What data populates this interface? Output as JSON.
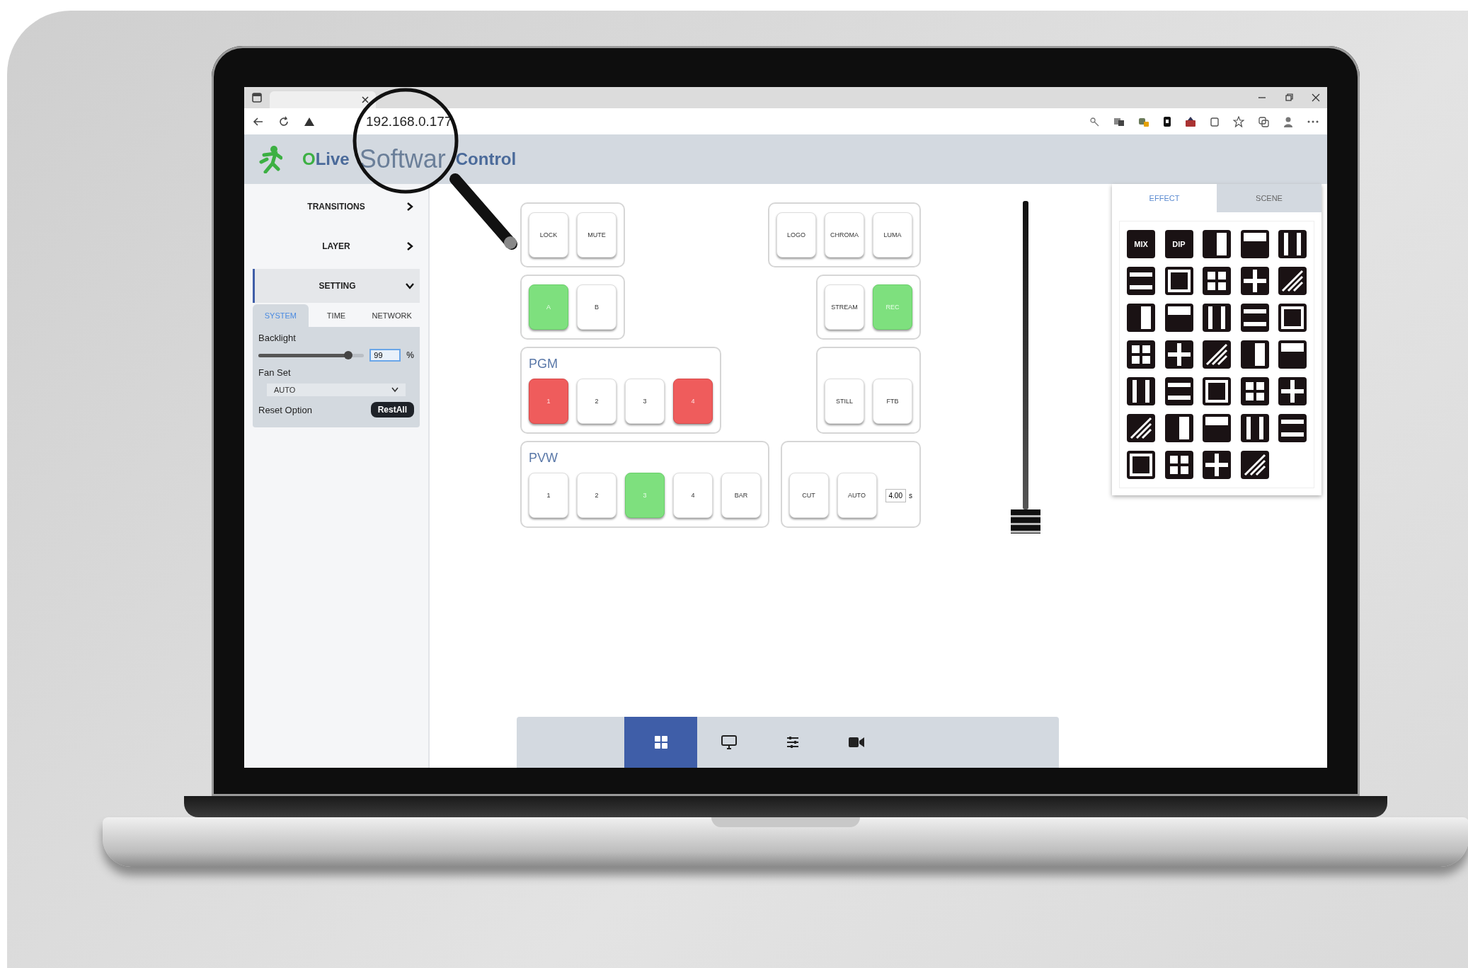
{
  "browser": {
    "address": "192.168.0.177"
  },
  "app": {
    "brand": "OLive",
    "brand_zoomed": "Softwar",
    "brand_suffix": "Control"
  },
  "sidebar": {
    "items": [
      {
        "label": "TRANSITIONS",
        "expanded": false
      },
      {
        "label": "LAYER",
        "expanded": false
      },
      {
        "label": "SETTING",
        "expanded": true
      }
    ]
  },
  "settings": {
    "tabs": [
      {
        "label": "SYSTEM",
        "selected": true
      },
      {
        "label": "TIME",
        "selected": false
      },
      {
        "label": "NETWORK",
        "selected": false
      }
    ],
    "backlight": {
      "label": "Backlight",
      "level": 0.85,
      "value": "99",
      "unit": "%"
    },
    "fan": {
      "label": "Fan Set",
      "value": "AUTO"
    },
    "reset": {
      "label": "Reset Option",
      "button": "RestAll"
    }
  },
  "control_rows": [
    {
      "left": {
        "buttons": [
          {
            "label": "LOCK",
            "selected": false
          },
          {
            "label": "MUTE",
            "selected": false
          }
        ]
      },
      "right": {
        "buttons": [
          {
            "label": "LOGO",
            "selected": false
          },
          {
            "label": "CHROMA",
            "selected": false
          },
          {
            "label": "LUMA",
            "selected": false
          }
        ]
      }
    },
    {
      "left": {
        "kind": "preview",
        "buttons": [
          {
            "label": "A",
            "selected": true
          },
          {
            "label": "B",
            "selected": false
          }
        ]
      },
      "right": {
        "kind": "preview",
        "buttons": [
          {
            "label": "STREAM",
            "selected": false
          },
          {
            "label": "REC",
            "selected": true
          }
        ]
      }
    },
    {
      "left": {
        "kind": "program",
        "title": "PGM",
        "buttons": [
          {
            "label": "1",
            "selected": true
          },
          {
            "label": "2",
            "selected": false
          },
          {
            "label": "3",
            "selected": false
          },
          {
            "label": "4",
            "selected": true
          }
        ]
      },
      "right": {
        "buttons": [
          {
            "label": "STILL",
            "selected": false
          },
          {
            "label": "FTB",
            "selected": false
          }
        ]
      }
    },
    {
      "left": {
        "kind": "preview",
        "title": "PVW",
        "buttons": [
          {
            "label": "1",
            "selected": false
          },
          {
            "label": "2",
            "selected": false
          },
          {
            "label": "3",
            "selected": true
          },
          {
            "label": "4",
            "selected": false
          },
          {
            "label": "BAR",
            "selected": false
          }
        ]
      },
      "right": {
        "buttons": [
          {
            "label": "CUT",
            "selected": false
          },
          {
            "label": "AUTO",
            "selected": false
          }
        ],
        "duration": {
          "value": "4.00",
          "unit": "s"
        }
      }
    }
  ],
  "fader": {
    "level": 0
  },
  "effects": {
    "tabs": [
      {
        "label": "EFFECT",
        "selected": true
      },
      {
        "label": "SCENE",
        "selected": false
      }
    ],
    "items": [
      {
        "label": "MIX"
      },
      {
        "label": "DIP"
      }
    ]
  },
  "bottom_nav": [
    {
      "kind": "grid",
      "selected": true
    },
    {
      "kind": "monitor",
      "selected": false
    },
    {
      "kind": "sliders",
      "selected": false
    },
    {
      "kind": "camera",
      "selected": false
    }
  ]
}
